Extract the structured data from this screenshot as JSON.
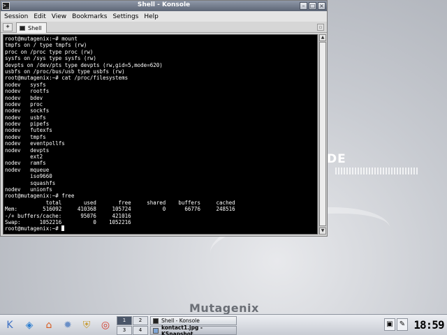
{
  "window": {
    "title": "Shell - Konsole",
    "menu": [
      "Session",
      "Edit",
      "View",
      "Bookmarks",
      "Settings",
      "Help"
    ],
    "tab_label": "Shell"
  },
  "terminal": {
    "lines": [
      "root@mutagenix:~# mount",
      "tmpfs on / type tmpfs (rw)",
      "proc on /proc type proc (rw)",
      "sysfs on /sys type sysfs (rw)",
      "devpts on /dev/pts type devpts (rw,gid=5,mode=620)",
      "usbfs on /proc/bus/usb type usbfs (rw)",
      "root@mutagenix:~# cat /proc/filesystems",
      "nodev   sysfs",
      "nodev   rootfs",
      "nodev   bdev",
      "nodev   proc",
      "nodev   sockfs",
      "nodev   usbfs",
      "nodev   pipefs",
      "nodev   futexfs",
      "nodev   tmpfs",
      "nodev   eventpollfs",
      "nodev   devpts",
      "        ext2",
      "nodev   ramfs",
      "nodev   mqueue",
      "        iso9660",
      "        squashfs",
      "nodev   unionfs",
      "root@mutagenix:~# free",
      "             total       used       free     shared    buffers     cached",
      "Mem:        516092     410368     105724          0      66776     248516",
      "-/+ buffers/cache:      95076     421016",
      "Swap:      1052216          0    1052216"
    ],
    "prompt": "root@mutagenix:~# "
  },
  "desktop": {
    "logo_text": "DE",
    "brand": "Mutagenix"
  },
  "taskbar": {
    "launchers": [
      {
        "name": "k-menu-icon",
        "glyph": "K",
        "color": "#3b6fc4"
      },
      {
        "name": "konqueror-icon",
        "glyph": "◈",
        "color": "#2f7fd0"
      },
      {
        "name": "home-icon",
        "glyph": "⌂",
        "color": "#d85a1f"
      },
      {
        "name": "network-icon",
        "glyph": "✹",
        "color": "#6a8fc7"
      },
      {
        "name": "shield-icon",
        "glyph": "⛨",
        "color": "#c79a2e"
      },
      {
        "name": "lifebuoy-icon",
        "glyph": "◎",
        "color": "#d43b2a"
      }
    ],
    "pager": [
      "1",
      "2",
      "3",
      "4"
    ],
    "active_desktop": 0,
    "tasks": [
      {
        "label": "Shell - Konsole"
      },
      {
        "label": "kontact1.jpg - KSnapshot"
      }
    ],
    "active_task": 1,
    "clock": "18:59"
  }
}
